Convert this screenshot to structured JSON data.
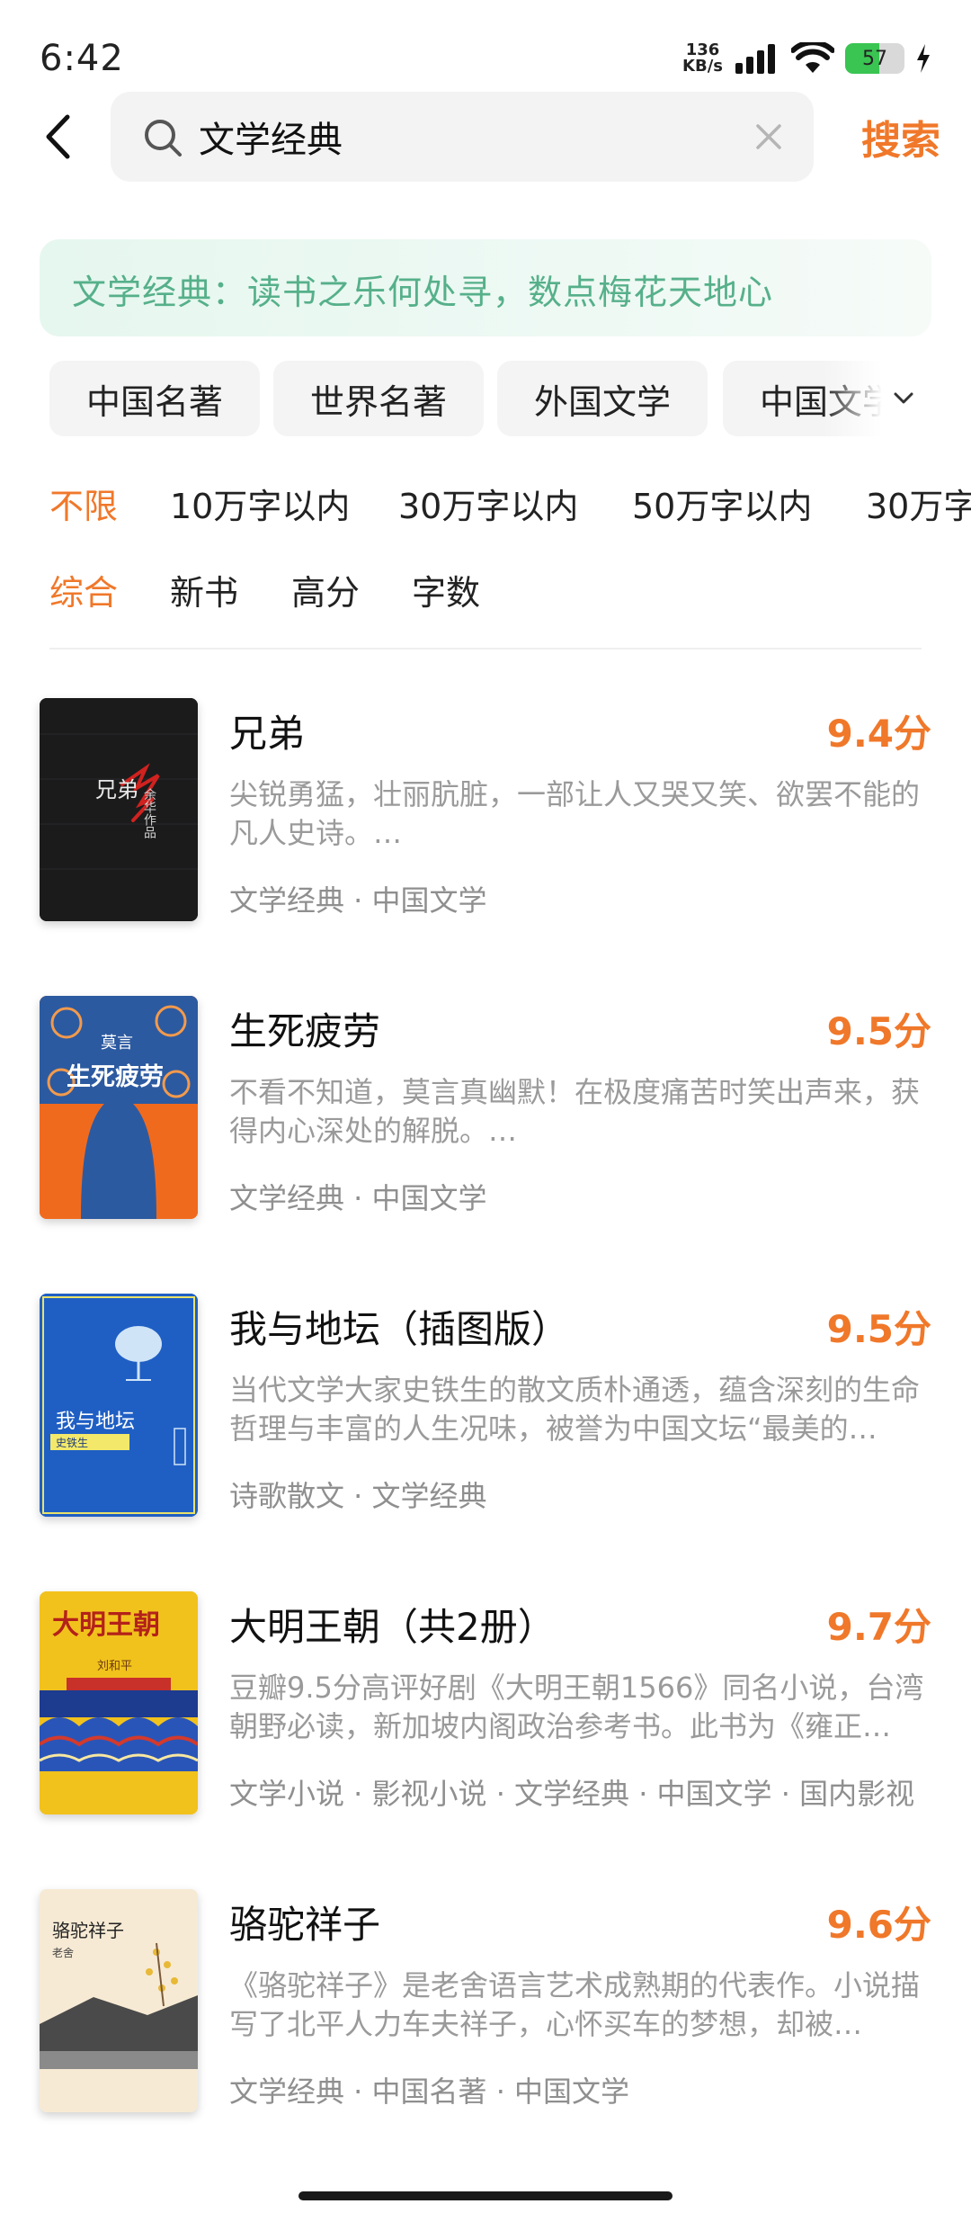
{
  "status_bar": {
    "time": "6:42",
    "speed_value": "136",
    "speed_unit": "KB/s",
    "battery_level": "57",
    "battery_fraction": 0.57
  },
  "search": {
    "query": "文学经典",
    "submit_label": "搜索"
  },
  "banner": {
    "text": "文学经典：读书之乐何处寻，数点梅花天地心"
  },
  "categories": [
    "中国名著",
    "世界名著",
    "外国文学",
    "中国文学"
  ],
  "word_filters": [
    "不限",
    "10万字以内",
    "30万字以内",
    "50万字以内",
    "30万字"
  ],
  "sort_filters": [
    "综合",
    "新书",
    "高分",
    "字数"
  ],
  "books": [
    {
      "title": "兄弟",
      "score": "9.4分",
      "desc": "尖锐勇猛，壮丽肮脏，一部让人又哭又笑、欲罢不能的凡人史诗。…",
      "tags": "文学经典 · 中国文学",
      "cover_title": "兄弟",
      "cover_author": "余华作品",
      "cover_color": "#1b1b1c"
    },
    {
      "title": "生死疲劳",
      "score": "9.5分",
      "desc": "不看不知道，莫言真幽默！在极度痛苦时笑出声来，获得内心深处的解脱。…",
      "tags": "文学经典 · 中国文学",
      "cover_title": "生死疲劳",
      "cover_author": "莫言",
      "cover_color": "#f06a1e"
    },
    {
      "title": "我与地坛（插图版）",
      "score": "9.5分",
      "desc": "当代文学大家史铁生的散文质朴通透，蕴含深刻的生命哲理与丰富的人生况味，被誉为中国文坛“最美的…",
      "tags": "诗歌散文 · 文学经典",
      "cover_title": "我与地坛",
      "cover_author": "史铁生",
      "cover_color": "#1f5fc4"
    },
    {
      "title": "大明王朝（共2册）",
      "score": "9.7分",
      "desc": "豆瓣9.5分高评好剧《大明王朝1566》同名小说，台湾朝野必读，新加坡内阁政治参考书。此书为《雍正…",
      "tags": "文学小说 · 影视小说 · 文学经典 · 中国文学 · 国内影视",
      "cover_title": "大明王朝",
      "cover_author": "刘和平",
      "cover_color": "#f2c21c"
    },
    {
      "title": "骆驼祥子",
      "score": "9.6分",
      "desc": "《骆驼祥子》是老舍语言艺术成熟期的代表作。小说描写了北平人力车夫祥子，心怀买车的梦想，却被…",
      "tags": "文学经典 · 中国名著 · 中国文学",
      "cover_title": "骆驼祥子",
      "cover_author": "老舍",
      "cover_color": "#f7ead4"
    }
  ],
  "colors": {
    "accent": "#f0782a",
    "banner_text": "#56b08a",
    "muted": "#9a9a9a"
  }
}
